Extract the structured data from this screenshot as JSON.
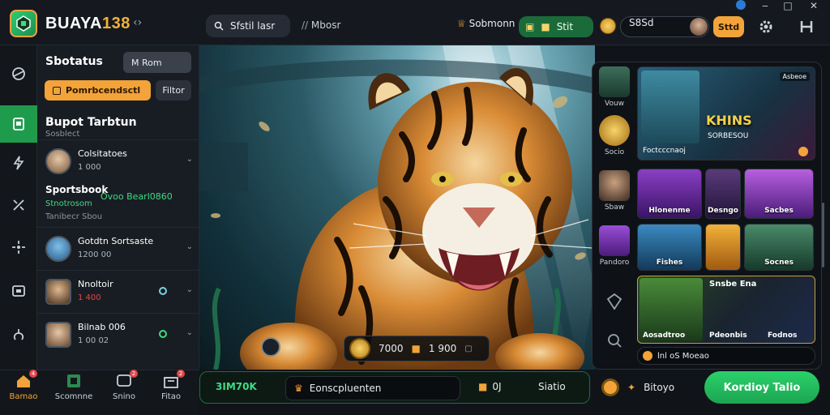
{
  "brand": {
    "name": "BUAYA",
    "number": "138"
  },
  "topbar": {
    "search_label": "Sfstil lasr",
    "nav_link": "Mbosr",
    "nav_link2": "Sobmonn",
    "balance_label": "Stit",
    "user_value": "S8Sd",
    "deposit_label": "Sttd",
    "window_controls": [
      "‒",
      "□",
      "✕"
    ]
  },
  "panel": {
    "title": "Sbotatus",
    "select_value": "M Rom",
    "promo_label": "Pomrbcendsctl",
    "filter_label": "Filtor",
    "section_title": "Bupot Tarbtun",
    "section_sub": "Sosblect",
    "rows": [
      {
        "name": "Colsitatoes",
        "value": "1 000"
      },
      {
        "name": "Gotdtn Sortsaste",
        "value": "1200 00"
      },
      {
        "name": "Nnoltoir",
        "value": "1 400"
      },
      {
        "name": "Bilnab 006",
        "value": "1 00 02"
      }
    ],
    "sportsbook": {
      "title": "Sportsbook",
      "live": "Ovoo Bearl0860",
      "sub": "Stnotrosom",
      "sub2": "Tanibecr Sbou"
    }
  },
  "bottom_nav": [
    {
      "label": "Bamao",
      "badge": "4",
      "icon": "home-icon"
    },
    {
      "label": "Scomnne",
      "badge": "",
      "icon": "grid-icon"
    },
    {
      "label": "Snino",
      "badge": "2",
      "icon": "chat-icon"
    },
    {
      "label": "Fitao",
      "badge": "2",
      "icon": "store-icon"
    }
  ],
  "hero": {
    "stat_left": "7000",
    "stat_right": "1 900"
  },
  "game_panel": {
    "side_categories": [
      "Vouw",
      "Socio",
      "Sbaw",
      "Pandoro",
      "",
      ""
    ],
    "featured": {
      "title": "KHINS",
      "subtitle": "SORBESOU",
      "caption": "Foctcccnaoj",
      "badge": "Asbeoe"
    },
    "tiles": [
      {
        "label": "Hlonenme"
      },
      {
        "label": "Desngo"
      },
      {
        "label": "Sacbes"
      },
      {
        "label": "Fishes"
      },
      {
        "label": ""
      },
      {
        "label": "Socnes"
      }
    ],
    "featured2": {
      "title": "Snsbe Ena",
      "tile_a": "Aosadtroo",
      "tile_b": "Pdeonbis",
      "tile_c": "Fodnos"
    },
    "ticker": "lnl oS Moeao"
  },
  "action_bar": {
    "count": "3IM70K",
    "field_label": "Eonscpluenten",
    "gift_value": "0J",
    "status": "Siatio",
    "profile_label": "Bitoyo",
    "cta_label": "Kordioy Talio"
  },
  "colors": {
    "accent": "#f2a33a",
    "primary_green": "#1f9b4e",
    "cta_green": "#22c55e"
  }
}
